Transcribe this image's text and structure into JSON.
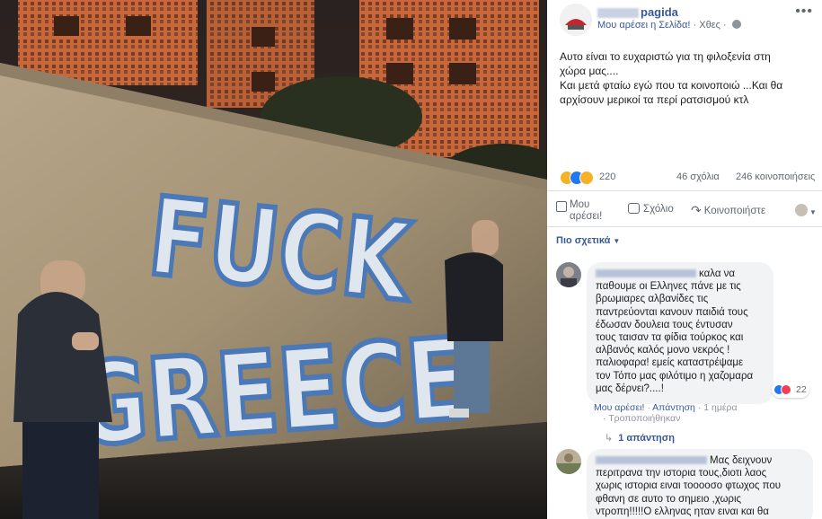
{
  "post": {
    "page_name": "pagida",
    "liked_label": "Μου αρέσει η Σελίδα!",
    "time": "Χθες",
    "more": "•••",
    "text_lines": [
      "Αυτο είναι το ευχαριστώ για τη φιλοξενία στη",
      "χώρα μας....",
      "Και μετά φταίω εγώ που τα κοινοποιώ ...Και θα",
      "αρχίσουν μερικοί τα περί ρατσισμού κτλ"
    ],
    "reactions_count": "220",
    "comments_count": "46 σχόλια",
    "shares_count": "246 κοινοποιήσεις"
  },
  "actions": {
    "like": "Μου αρέσει!",
    "comment": "Σχόλιο",
    "share": "Κοινοποιήστε"
  },
  "comments_filter": "Πιο σχετικά",
  "comments": [
    {
      "lines": [
        "καλα να",
        "παθουμε οι Ελληνες πάνε με τις",
        "βρωμιαρες αλβανίδες τις",
        "παντρεύονται κανουν παιδιά τους",
        "έδωσαν δουλεια τους έντυσαν",
        "τους ταισαν τα φίδια τούρκος και",
        "αλβανός καλός μονο νεκρός !",
        "παλιοφαρα! εμείς καταστρέψαμε",
        "τον Τόπο μας φιλότιμο η χαζομαρα",
        "μας δέρνει?....!"
      ],
      "reactions": "22",
      "like": "Μου αρέσει!",
      "reply": "Απάντηση",
      "time": "1 ημέρα",
      "edited": "Τροποποιήθηκαν",
      "replies": "1 απάντηση"
    },
    {
      "lines": [
        "Μας δειχνουν",
        "περιτρανα την ιστορια τους,διοτι λαος",
        "χωρις ιστορια ειναι τοοοοσο φτωχος που",
        "φθανη σε αυτο το σημειο ,χωρις",
        "ντροπη!!!!!Ο ελληνας ηταν ειναι και θα"
      ]
    }
  ],
  "photo": {
    "graffiti_line1": "FUCK",
    "graffiti_line2": "GREECE"
  },
  "icons": [
    "page-avatar-icon",
    "globe-icon",
    "haha-reaction-icon",
    "like-reaction-icon",
    "sad-reaction-icon",
    "thumb-icon",
    "comment-icon",
    "share-icon",
    "user-avatar-icon",
    "love-reaction-icon"
  ],
  "colors": {
    "link": "#385898",
    "text": "#1c1e21",
    "muted": "#606770",
    "bubble": "#f2f3f5",
    "like": "#2078f4"
  }
}
